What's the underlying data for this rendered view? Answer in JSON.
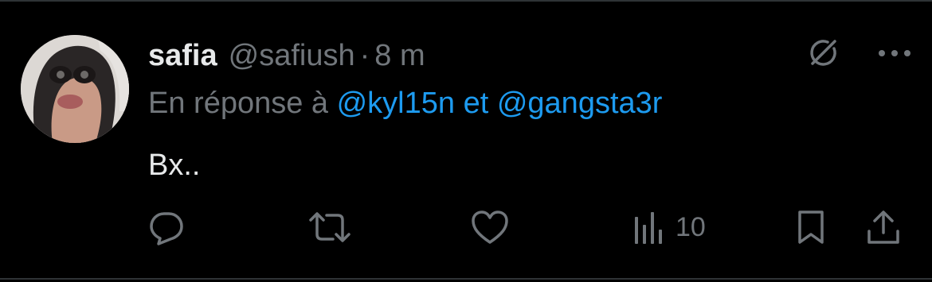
{
  "tweet": {
    "author": {
      "display_name": "safia",
      "handle": "@safiush",
      "separator": "·",
      "timestamp": "8 m"
    },
    "reply_to": {
      "prefix": "En réponse à ",
      "mention_1": "@kyl15n",
      "joiner": " et ",
      "mention_2": "@gangsta3r"
    },
    "text": "Bx..",
    "stats": {
      "views": "10"
    },
    "icons": {
      "top": [
        "grok-icon",
        "more-options-icon"
      ],
      "actions": [
        "reply-icon",
        "retweet-icon",
        "like-icon",
        "views-icon",
        "bookmark-icon",
        "share-icon"
      ]
    },
    "colors": {
      "background": "#000000",
      "primary_text": "#e7e9ea",
      "secondary_text": "#71767b",
      "mention": "#1d9bf0",
      "divider": "#2f3336"
    }
  }
}
